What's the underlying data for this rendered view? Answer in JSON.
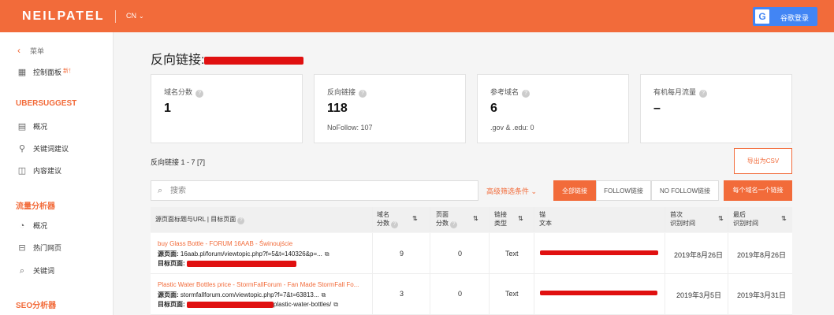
{
  "header": {
    "logo": "NEILPATEL",
    "lang": "CN",
    "google_icon": "G",
    "login_label": "谷歌登录"
  },
  "sidebar": {
    "back_label": "菜单",
    "dashboard_label": "控制面板",
    "new_badge": "新！",
    "ubersuggest_heading": "UBERSUGGEST",
    "uber_items": [
      "概况",
      "关键词建议",
      "内容建议"
    ],
    "traffic_heading": "流量分析器",
    "traffic_items": [
      "概况",
      "热门网页",
      "关键词"
    ],
    "seo_heading": "SEO分析器"
  },
  "page": {
    "title": "反向链接:",
    "cards": [
      {
        "label": "域名分数",
        "value": "1",
        "sub": ""
      },
      {
        "label": "反向链接",
        "value": "118",
        "sub": "NoFollow: 107"
      },
      {
        "label": "参考域名",
        "value": "6",
        "sub": ".gov & .edu: 0"
      },
      {
        "label": "有机每月流量",
        "value": "–",
        "sub": ""
      }
    ],
    "help_icon": "?",
    "count_text": "反向链接  1 - 7 [7]",
    "export_label": "导出为CSV",
    "search_placeholder": "搜索",
    "advanced_filter": "高级筛选条件",
    "filters": [
      "全部链接",
      "FOLLOW链接",
      "NO FOLLOW链接"
    ],
    "per_domain": "每个域名一个链接"
  },
  "table": {
    "headers": {
      "source": "源页面标题与URL | 目标页面",
      "domain_score_1": "域名",
      "domain_score_2": "分数",
      "page_score_1": "页面",
      "page_score_2": "分数",
      "link_type_1": "链接",
      "link_type_2": "类型",
      "anchor_1": "锚",
      "anchor_2": "文本",
      "first_seen_1": "首次",
      "first_seen_2": "识别时间",
      "last_seen_1": "最后",
      "last_seen_2": "识别时间"
    },
    "source_label": "源页面:",
    "target_label": "目标页面:",
    "rows": [
      {
        "title": "buy Glass Bottle - FORUM 16AAB - Świnoujście",
        "source_url": "16aab.pl/forum/viewtopic.php?f=5&t=140326&p=...",
        "target_url": "",
        "domain_score": "9",
        "page_score": "0",
        "link_type": "Text",
        "first_seen": "2019年8月26日",
        "last_seen": "2019年8月26日"
      },
      {
        "title": "Plastic Water Bottles price - StormFallForum - Fan Made StormFall Fo...",
        "source_url": "stormfallforum.com/viewtopic.php?f=7&t=63813...",
        "target_url": "plastic-water-bottles/",
        "domain_score": "3",
        "page_score": "0",
        "link_type": "Text",
        "first_seen": "2019年3月5日",
        "last_seen": "2019年3月31日"
      }
    ]
  }
}
